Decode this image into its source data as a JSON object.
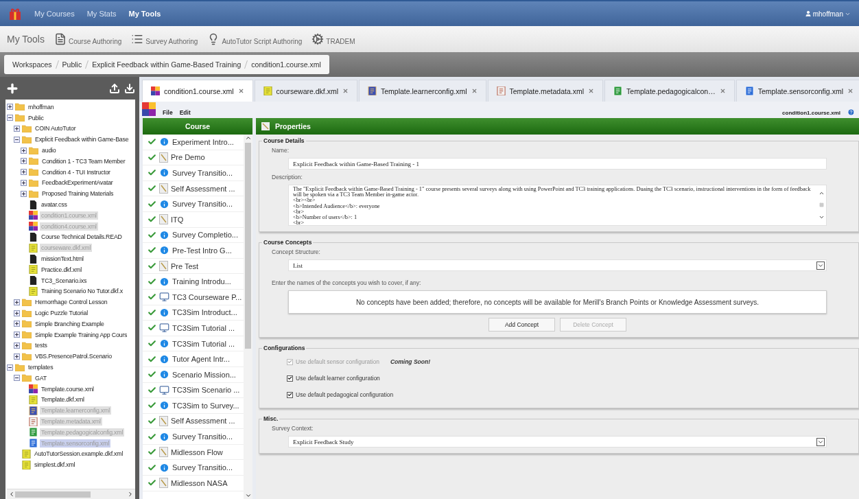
{
  "nav": {
    "items": [
      {
        "label": "My Courses",
        "selected": false
      },
      {
        "label": "My Stats",
        "selected": false
      },
      {
        "label": "My Tools",
        "selected": true
      }
    ],
    "user": "mhoffman"
  },
  "tools": {
    "title": "My Tools",
    "items": [
      {
        "label": "Course Authoring",
        "kind": "doc"
      },
      {
        "label": "Survey Authoring",
        "kind": "list"
      },
      {
        "label": "AutoTutor Script Authoring",
        "kind": "bulb"
      },
      {
        "label": "TRADEM",
        "kind": "gears"
      }
    ]
  },
  "breadcrumb": [
    "Workspaces",
    "Public",
    "Explicit Feedback within Game-Based Training",
    "condition1.course.xml"
  ],
  "tree": [
    {
      "label": "mhoffman",
      "kind": "folder",
      "expanded": false,
      "selected": false
    },
    {
      "label": "Public",
      "kind": "folder",
      "expanded": true,
      "selected": false,
      "children": [
        {
          "label": "COIN AutoTutor",
          "kind": "folder",
          "expanded": false,
          "selected": false
        },
        {
          "label": "Explicit Feedback within Game-Base",
          "kind": "folder",
          "expanded": true,
          "selected": false,
          "children": [
            {
              "label": "audio",
              "kind": "folder",
              "expanded": false,
              "selected": false
            },
            {
              "label": "Condition 1 - TC3 Team Member",
              "kind": "folder",
              "expanded": false,
              "selected": false
            },
            {
              "label": "Condition 4 - TUI Instructor",
              "kind": "folder",
              "expanded": false,
              "selected": false
            },
            {
              "label": "FeedbackExperimentAvatar",
              "kind": "folder",
              "expanded": false,
              "selected": false
            },
            {
              "label": "Proposed Training Materials",
              "kind": "folder",
              "expanded": false,
              "selected": false
            },
            {
              "label": "avatar.css",
              "kind": "doc",
              "open": false,
              "selected": false
            },
            {
              "label": "condition1.course.xml",
              "kind": "course",
              "open": true,
              "selected": false
            },
            {
              "label": "condition4.course.xml",
              "kind": "course",
              "open": true,
              "selected": false
            },
            {
              "label": "Course Technical Details.READ",
              "kind": "doc",
              "open": false,
              "selected": false
            },
            {
              "label": "courseware.dkf.xml",
              "kind": "dkf",
              "open": true,
              "selected": false
            },
            {
              "label": "missionText.html",
              "kind": "doc",
              "open": false,
              "selected": false
            },
            {
              "label": "Practice.dkf.xml",
              "kind": "dkf",
              "open": false,
              "selected": false
            },
            {
              "label": "TC3_Scenario.ixs",
              "kind": "doc",
              "open": false,
              "selected": false
            },
            {
              "label": "Training Scenario No Tutor.dkf.x",
              "kind": "dkf",
              "open": false,
              "selected": false
            }
          ]
        },
        {
          "label": "Hemorrhage Control Lesson",
          "kind": "folder",
          "expanded": false,
          "selected": false
        },
        {
          "label": "Logic Puzzle Tutorial",
          "kind": "folder",
          "expanded": false,
          "selected": false
        },
        {
          "label": "Simple Branching Example",
          "kind": "folder",
          "expanded": false,
          "selected": false
        },
        {
          "label": "Simple Example Training App Cours",
          "kind": "folder",
          "expanded": false,
          "selected": false
        },
        {
          "label": "tests",
          "kind": "folder",
          "expanded": false,
          "selected": false
        },
        {
          "label": "VBS.PresencePatrol.Scenario",
          "kind": "folder",
          "expanded": false,
          "selected": false
        }
      ]
    },
    {
      "label": "templates",
      "kind": "folder",
      "expanded": true,
      "selected": false,
      "children": [
        {
          "label": "GAT",
          "kind": "folder",
          "expanded": true,
          "selected": false,
          "children": [
            {
              "label": "Template.course.xml",
              "kind": "course",
              "open": false,
              "selected": false
            },
            {
              "label": "Template.dkf.xml",
              "kind": "dkf",
              "open": false,
              "selected": false
            },
            {
              "label": "Template.learnerconfig.xml",
              "kind": "learner",
              "open": true,
              "selected": false
            },
            {
              "label": "Template.metadata.xml",
              "kind": "metadata",
              "open": true,
              "selected": false
            },
            {
              "label": "Template.pedagogicalconfig.xml",
              "kind": "pedagogical",
              "open": true,
              "selected": false
            },
            {
              "label": "Template.sensorconfig.xml",
              "kind": "sensor",
              "open": true,
              "selected": true
            }
          ]
        },
        {
          "label": "AutoTutorSession.example.dkf.xml",
          "kind": "dkf",
          "open": false,
          "selected": false
        },
        {
          "label": "simplest.dkf.xml",
          "kind": "dkf",
          "open": false,
          "selected": false
        }
      ]
    }
  ],
  "tabs": [
    {
      "label": "condition1.course.xml",
      "kind": "course",
      "selected": true
    },
    {
      "label": "courseware.dkf.xml",
      "kind": "dkf",
      "selected": false
    },
    {
      "label": "Template.learnerconfig.xml",
      "kind": "learner",
      "selected": false
    },
    {
      "label": "Template.metadata.xml",
      "kind": "metadata",
      "selected": false
    },
    {
      "label": "Template.pedagogicalcon…",
      "kind": "pedagogical",
      "selected": false
    },
    {
      "label": "Template.sensorconfig.xml",
      "kind": "sensor",
      "selected": false
    }
  ],
  "menu": [
    "File",
    "Edit"
  ],
  "file_name": "condition1.course.xml",
  "course": {
    "title": "Course",
    "items": [
      {
        "label": "Experiment Intro...",
        "kind": "info"
      },
      {
        "label": "Pre Demo",
        "kind": "survey"
      },
      {
        "label": "Survey Transitio...",
        "kind": "info"
      },
      {
        "label": "Self Assessment ...",
        "kind": "survey"
      },
      {
        "label": "Survey Transitio...",
        "kind": "info"
      },
      {
        "label": "ITQ",
        "kind": "survey"
      },
      {
        "label": "Survey Completio...",
        "kind": "info"
      },
      {
        "label": "Pre-Test Intro G...",
        "kind": "info"
      },
      {
        "label": "Pre Test",
        "kind": "survey"
      },
      {
        "label": "Training Introdu...",
        "kind": "info"
      },
      {
        "label": "TC3 Courseware P...",
        "kind": "computer"
      },
      {
        "label": "TC3Sim Introduct...",
        "kind": "info"
      },
      {
        "label": "TC3Sim Tutorial ...",
        "kind": "computer"
      },
      {
        "label": "TC3Sim Tutorial ...",
        "kind": "info"
      },
      {
        "label": "Tutor Agent Intr...",
        "kind": "info"
      },
      {
        "label": "Scenario Mission...",
        "kind": "info"
      },
      {
        "label": "TC3Sim Scenario ...",
        "kind": "computer"
      },
      {
        "label": "TC3Sim to Survey...",
        "kind": "info"
      },
      {
        "label": "Self Assessment ...",
        "kind": "survey"
      },
      {
        "label": "Survey Transitio...",
        "kind": "info"
      },
      {
        "label": "Midlesson Flow",
        "kind": "survey"
      },
      {
        "label": "Survey Transitio...",
        "kind": "info"
      },
      {
        "label": "Midlesson NASA",
        "kind": "survey"
      }
    ]
  },
  "properties": {
    "title": "Properties",
    "details": {
      "legend": "Course Details",
      "name_label": "Name:",
      "name": "Explicit Feedback within Game-Based Training - 1",
      "description_label": "Description:",
      "description": [
        "The \"Explicit Feedback within Game-Based Training - 1\" course presents several surveys along with using PowerPoint and TC3 training applications.  Duaing the TC3 scenario, instructional interventions in the form of feedback will be spoken via a TC3 Team Member in-game actor.",
        "<br><br>",
        "<b>Intended Audience</b>: everyone",
        "<br>",
        "<b>Number of users</b>: 1",
        "<br>"
      ]
    },
    "concepts": {
      "legend": "Course Concepts",
      "structure_label": "Concept Structure:",
      "structure": "List",
      "hint": "Enter the names of the concepts you wish to cover, if any:",
      "empty": "No concepts have been added; therefore, no concepts will be available for Merill's Branch Points or Knowledge Assessment surveys.",
      "buttons": [
        {
          "label": "Add Concept",
          "disabled": false
        },
        {
          "label": "Delete Concept",
          "disabled": true
        }
      ]
    },
    "configurations": {
      "legend": "Configurations",
      "options": [
        {
          "label": "Use default sensor configuration",
          "checked": true,
          "disabled": true,
          "note": "Coming Soon!"
        },
        {
          "label": "Use default learner configuration",
          "checked": true,
          "disabled": false
        },
        {
          "label": "Use default pedagogical configuration",
          "checked": true,
          "disabled": false
        }
      ]
    },
    "misc": {
      "legend": "Misc.",
      "context_label": "Survey Context:",
      "context": "Explicit Feedback Study"
    }
  }
}
